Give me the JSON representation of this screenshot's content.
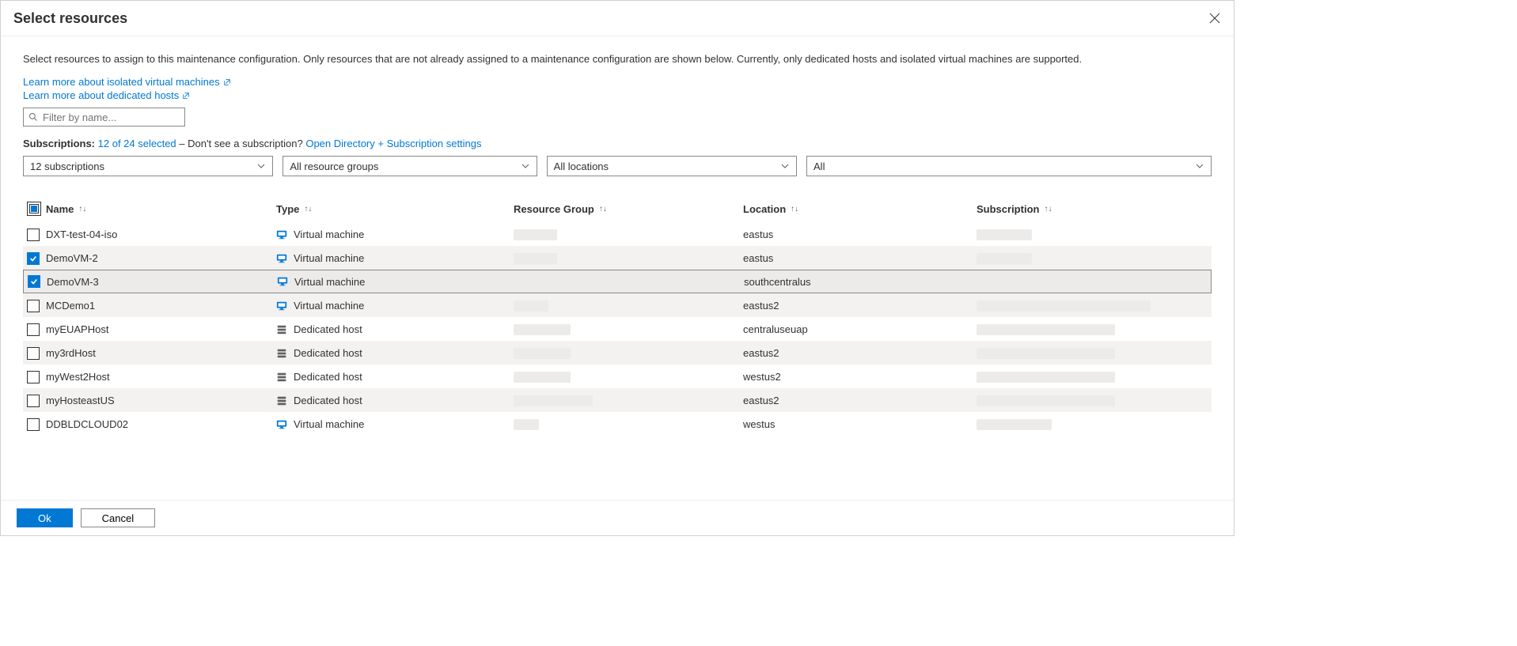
{
  "header": {
    "title": "Select resources"
  },
  "intro": "Select resources to assign to this maintenance configuration. Only resources that are not already assigned to a maintenance configuration are shown below. Currently, only dedicated hosts and isolated virtual machines are supported.",
  "links": {
    "isolated_vm": "Learn more about isolated virtual machines",
    "dedicated_hosts": "Learn more about dedicated hosts"
  },
  "filter": {
    "placeholder": "Filter by name..."
  },
  "subscriptions": {
    "label": "Subscriptions:",
    "selected_text": "12 of 24 selected",
    "dash": " – Don't see a subscription? ",
    "settings_link": "Open Directory + Subscription settings"
  },
  "dropdowns": {
    "subs": "12 subscriptions",
    "rg": "All resource groups",
    "loc": "All locations",
    "all": "All"
  },
  "columns": {
    "name": "Name",
    "type": "Type",
    "rg": "Resource Group",
    "loc": "Location",
    "sub": "Subscription"
  },
  "rows": [
    {
      "name": "DXT-test-04-iso",
      "type": "Virtual machine",
      "type_kind": "vm",
      "location": "eastus",
      "checked": false,
      "rg_w": 55,
      "sub_w": 70
    },
    {
      "name": "DemoVM-2",
      "type": "Virtual machine",
      "type_kind": "vm",
      "location": "eastus",
      "checked": true,
      "rg_w": 55,
      "sub_w": 70
    },
    {
      "name": "DemoVM-3",
      "type": "Virtual machine",
      "type_kind": "vm",
      "location": "southcentralus",
      "checked": true,
      "selected": true,
      "rg_w": 55,
      "sub_w": 70
    },
    {
      "name": "MCDemo1",
      "type": "Virtual machine",
      "type_kind": "vm",
      "location": "eastus2",
      "checked": false,
      "rg_w": 44,
      "sub_w": 220
    },
    {
      "name": "myEUAPHost",
      "type": "Dedicated host",
      "type_kind": "host",
      "location": "centraluseuap",
      "checked": false,
      "rg_w": 72,
      "sub_w": 175
    },
    {
      "name": "my3rdHost",
      "type": "Dedicated host",
      "type_kind": "host",
      "location": "eastus2",
      "checked": false,
      "rg_w": 72,
      "sub_w": 175
    },
    {
      "name": "myWest2Host",
      "type": "Dedicated host",
      "type_kind": "host",
      "location": "westus2",
      "checked": false,
      "rg_w": 72,
      "sub_w": 175
    },
    {
      "name": "myHosteastUS",
      "type": "Dedicated host",
      "type_kind": "host",
      "location": "eastus2",
      "checked": false,
      "rg_w": 100,
      "sub_w": 175
    },
    {
      "name": "DDBLDCLOUD02",
      "type": "Virtual machine",
      "type_kind": "vm",
      "location": "westus",
      "checked": false,
      "rg_w": 32,
      "sub_w": 95
    }
  ],
  "footer": {
    "ok": "Ok",
    "cancel": "Cancel"
  }
}
